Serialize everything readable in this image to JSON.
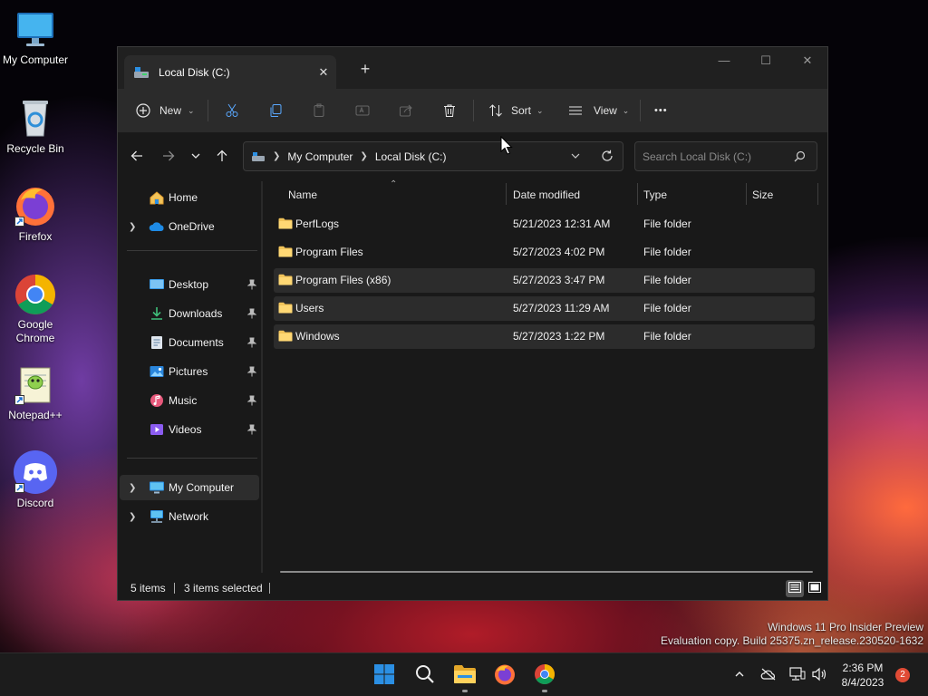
{
  "desktop": {
    "icons": [
      {
        "label_line1": "My Computer",
        "label_line2": ""
      },
      {
        "label_line1": "Recycle Bin",
        "label_line2": ""
      },
      {
        "label_line1": "Firefox",
        "label_line2": ""
      },
      {
        "label_line1": "Google",
        "label_line2": "Chrome"
      },
      {
        "label_line1": "Notepad++",
        "label_line2": ""
      },
      {
        "label_line1": "Discord",
        "label_line2": ""
      }
    ],
    "watermark": {
      "line1": "Windows 11 Pro Insider Preview",
      "line2": "Evaluation copy. Build 25375.zn_release.230520-1632"
    }
  },
  "window": {
    "tab_title": "Local Disk (C:)",
    "tab_close": "✕",
    "new_tab": "+",
    "controls": {
      "minimize": "—",
      "maximize": "☐",
      "close": "✕"
    },
    "toolbar": {
      "new_label": "New",
      "sort_label": "Sort",
      "view_label": "View",
      "more_label": "•••"
    },
    "address": {
      "crumbs": [
        "My Computer",
        "Local Disk (C:)"
      ],
      "search_placeholder": "Search Local Disk (C:)"
    },
    "nav": {
      "home": "Home",
      "onedrive": "OneDrive",
      "quick": [
        "Desktop",
        "Downloads",
        "Documents",
        "Pictures",
        "Music",
        "Videos"
      ],
      "my_computer": "My Computer",
      "network": "Network"
    },
    "columns": {
      "name": "Name",
      "date": "Date modified",
      "type": "Type",
      "size": "Size"
    },
    "rows": [
      {
        "name": "PerfLogs",
        "date": "5/21/2023 12:31 AM",
        "type": "File folder",
        "size": "",
        "selected": false
      },
      {
        "name": "Program Files",
        "date": "5/27/2023 4:02 PM",
        "type": "File folder",
        "size": "",
        "selected": false
      },
      {
        "name": "Program Files (x86)",
        "date": "5/27/2023 3:47 PM",
        "type": "File folder",
        "size": "",
        "selected": true
      },
      {
        "name": "Users",
        "date": "5/27/2023 11:29 AM",
        "type": "File folder",
        "size": "",
        "selected": true
      },
      {
        "name": "Windows",
        "date": "5/27/2023 1:22 PM",
        "type": "File folder",
        "size": "",
        "selected": true
      }
    ],
    "status": {
      "item_count": "5 items",
      "selected_count": "3 items selected"
    }
  },
  "taskbar": {
    "time": "2:36 PM",
    "date": "8/4/2023",
    "notification_count": "2"
  },
  "colors": {
    "accent_folder": "#f2c45a",
    "window_bg": "#191919",
    "toolbar_bg": "#2b2b2b",
    "taskbar_bg": "#1c1c1c",
    "badge": "#e04b35",
    "windows_blue": "#2b8fe3"
  }
}
